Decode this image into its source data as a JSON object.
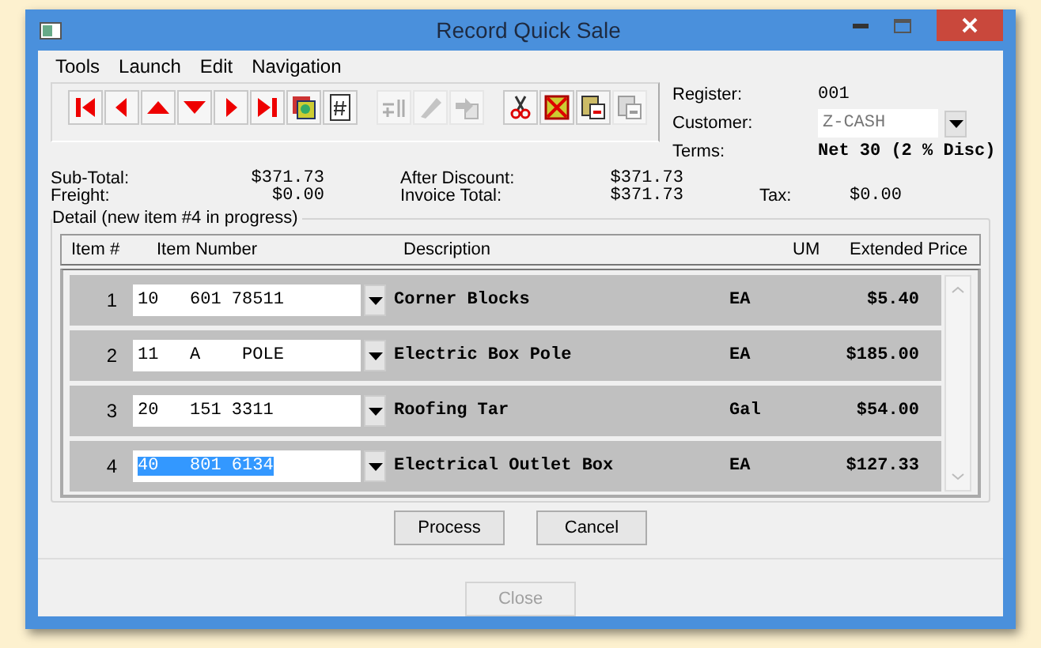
{
  "window": {
    "title": "Record Quick Sale"
  },
  "menu": [
    "Tools",
    "Launch",
    "Edit",
    "Navigation"
  ],
  "toolbar": [
    [
      {
        "kind": "first",
        "disabled": false
      },
      {
        "kind": "prev",
        "disabled": false
      },
      {
        "kind": "up",
        "disabled": false
      },
      {
        "kind": "down",
        "disabled": false
      },
      {
        "kind": "next",
        "disabled": false
      },
      {
        "kind": "last",
        "disabled": false
      },
      {
        "kind": "find",
        "disabled": false
      },
      {
        "kind": "number",
        "disabled": false
      }
    ],
    [
      {
        "kind": "insert",
        "disabled": true
      },
      {
        "kind": "erase",
        "disabled": true
      },
      {
        "kind": "copy",
        "disabled": true
      }
    ],
    [
      {
        "kind": "cut",
        "disabled": false
      },
      {
        "kind": "delete",
        "disabled": false
      },
      {
        "kind": "paste",
        "disabled": false
      },
      {
        "kind": "paste",
        "disabled": true
      }
    ]
  ],
  "header": {
    "register_label": "Register:",
    "register": "001",
    "customer_label": "Customer:",
    "customer": "Z-CASH",
    "terms_label": "Terms:",
    "terms": "Net 30 (2 % Disc)"
  },
  "totals": {
    "subtotal_label": "Sub-Total:",
    "subtotal": "$371.73",
    "freight_label": "Freight:",
    "freight": "$0.00",
    "after_discount_label": "After Discount:",
    "after_discount": "$371.73",
    "invoice_total_label": "Invoice Total:",
    "invoice_total": "$371.73",
    "tax_label": "Tax:",
    "tax": "$0.00"
  },
  "detail": {
    "title": "Detail (new item #4 in progress)",
    "columns": [
      "Item #",
      "Item Number",
      "Description",
      "UM",
      "Extended Price"
    ],
    "rows": [
      {
        "item": "1",
        "item_number": "10   601 78511",
        "description": "Corner Blocks",
        "um": "EA",
        "price": "$5.40",
        "selected": false
      },
      {
        "item": "2",
        "item_number": "11   A    POLE",
        "description": "Electric Box Pole",
        "um": "EA",
        "price": "$185.00",
        "selected": false
      },
      {
        "item": "3",
        "item_number": "20   151 3311",
        "description": "Roofing Tar",
        "um": "Gal",
        "price": "$54.00",
        "selected": false
      },
      {
        "item": "4",
        "item_number": "40   801 6134",
        "description": "Electrical Outlet Box",
        "um": "EA",
        "price": "$127.33",
        "selected": true
      }
    ]
  },
  "buttons": [
    {
      "label": "Process",
      "disabled": false
    },
    {
      "label": "Cancel",
      "disabled": false
    }
  ],
  "close": {
    "label": "Close",
    "disabled": true
  }
}
